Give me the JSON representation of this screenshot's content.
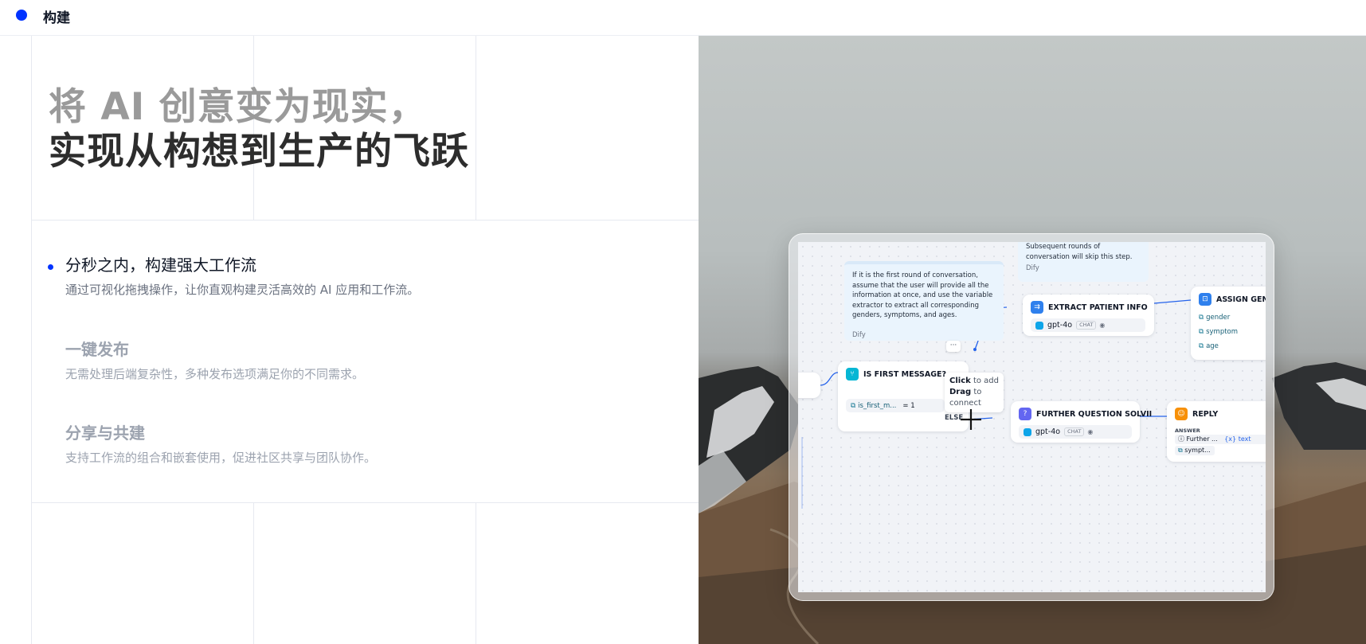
{
  "header": {
    "title": "构建",
    "dot_color": "#0033ff"
  },
  "hero": {
    "line1": "将 AI 创意变为现实，",
    "line2": "实现从构想到生产的飞跃"
  },
  "features": [
    {
      "title": "分秒之内，构建强大工作流",
      "desc": "通过可视化拖拽操作，让你直观构建灵活高效的 AI 应用和工作流。",
      "active": true
    },
    {
      "title": "一键发布",
      "desc": "无需处理后端复杂性，多种发布选项满足你的不同需求。",
      "active": false
    },
    {
      "title": "分享与共建",
      "desc": "支持工作流的组合和嵌套使用，促进社区共享与团队协作。",
      "active": false
    }
  ],
  "workflow": {
    "note_top": {
      "text": "Subsequent rounds of conversation will skip this step.",
      "source": "Dify"
    },
    "note_main": {
      "text": "If it is the first round of conversation, assume that the user will provide all the information at once, and use the variable extractor to extract all corresponding genders, symptoms, and ages.",
      "source": "Dify"
    },
    "node_if": {
      "title": "IS FIRST MESSAGE?",
      "condition_var": "is_first_m...",
      "condition_op": "= 1",
      "else_label": "ELSE",
      "more": "···",
      "icon": "branch-icon"
    },
    "node_extract": {
      "title": "EXTRACT PATIENT INFO",
      "model": "gpt-4o",
      "badge": "CHAT",
      "icon": "extract-icon"
    },
    "node_assign": {
      "title": "ASSIGN GENDE",
      "vars": [
        "gender",
        "symptom",
        "age"
      ],
      "icon": "assign-icon"
    },
    "node_further": {
      "title": "FURTHER QUESTION SOLVII",
      "model": "gpt-4o",
      "badge": "CHAT",
      "icon": "question-icon"
    },
    "node_reply": {
      "title": "REPLY",
      "answer_label": "ANSWER",
      "item1": "Further ...",
      "item1_tag": "text",
      "item1_tag_prefix": "{x}",
      "item2": "sympt...",
      "icon": "reply-icon"
    },
    "tooltip": {
      "click": "Click",
      "click_rest": " to add",
      "drag": "Drag",
      "drag_rest": " to",
      "connect": "connect"
    }
  }
}
